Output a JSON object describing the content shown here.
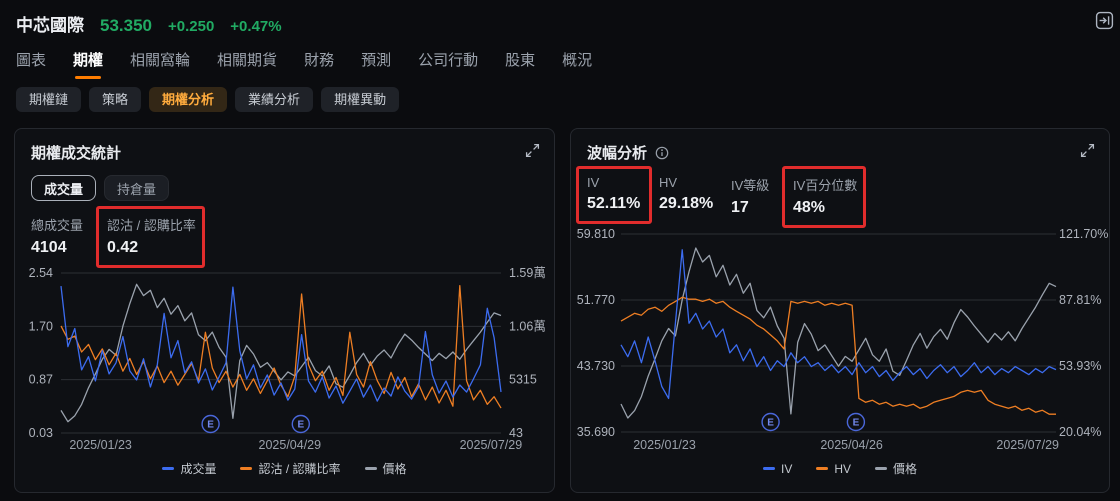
{
  "theme": {
    "up_color": "#21ab63",
    "accent_color": "#ff7d00",
    "annotation_color": "#e12c2c",
    "background": "#0b0c0f",
    "panel_background": "#0e1014"
  },
  "header": {
    "symbol": "中芯國際",
    "price": "53.350",
    "change": "+0.250",
    "change_pct": "+0.47%",
    "collapse_icon": "collapse-right-icon"
  },
  "tabs": [
    {
      "name": "chart",
      "label": "圖表",
      "active": false
    },
    {
      "name": "options",
      "label": "期權",
      "active": true
    },
    {
      "name": "related-warrants",
      "label": "相關窩輪",
      "active": false
    },
    {
      "name": "related-futures",
      "label": "相關期貨",
      "active": false
    },
    {
      "name": "financials",
      "label": "財務",
      "active": false
    },
    {
      "name": "forecast",
      "label": "預測",
      "active": false
    },
    {
      "name": "corporate-actions",
      "label": "公司行動",
      "active": false
    },
    {
      "name": "shareholders",
      "label": "股東",
      "active": false
    },
    {
      "name": "overview",
      "label": "概況",
      "active": false
    }
  ],
  "subtabs": [
    {
      "name": "option-chain",
      "label": "期權鏈",
      "active": false
    },
    {
      "name": "strategy",
      "label": "策略",
      "active": false
    },
    {
      "name": "option-analysis",
      "label": "期權分析",
      "active": true
    },
    {
      "name": "earnings-analysis",
      "label": "業績分析",
      "active": false
    },
    {
      "name": "option-unusual-activity",
      "label": "期權異動",
      "active": false
    }
  ],
  "panels": {
    "volume_stats": {
      "title": "期權成交統計",
      "expand_icon": "expand-icon",
      "toggles": [
        {
          "name": "volume",
          "label": "成交量",
          "active": true
        },
        {
          "name": "open-interest",
          "label": "持倉量",
          "active": false
        }
      ],
      "stats": [
        {
          "name": "total-volume",
          "label": "總成交量",
          "value": "4104",
          "highlighted": false
        },
        {
          "name": "put-call-ratio",
          "label": "認沽 / 認購比率",
          "value": "0.42",
          "highlighted": true
        }
      ],
      "chart": {
        "type": "line",
        "left_axis_labels": [
          "2.54",
          "1.70",
          "0.87",
          "0.03"
        ],
        "right_axis_labels": [
          "1.59萬",
          "1.06萬",
          "5315",
          "43"
        ],
        "left_axis_range": [
          0.03,
          2.54
        ],
        "right_axis_range": [
          43,
          15900
        ],
        "x_ticks": [
          {
            "label": "2025/01/23",
            "frac": 0.09
          },
          {
            "label": "2025/04/29",
            "frac": 0.52
          },
          {
            "label": "2025/07/29",
            "frac": 0.977
          }
        ],
        "earnings_marker": "E",
        "earnings_fracs": [
          0.34,
          0.545
        ],
        "series": [
          {
            "id": "volume",
            "name": "成交量",
            "color": "#3c6cf0",
            "min": 43,
            "max": 15900,
            "values": [
              14600,
              8600,
              10400,
              6300,
              7600,
              5200,
              8200,
              5900,
              7000,
              9600,
              6200,
              5300,
              7400,
              4600,
              6800,
              11900,
              7500,
              9200,
              6000,
              7100,
              5000,
              6400,
              4300,
              5600,
              7000,
              14500,
              8200,
              5400,
              6800,
              4500,
              5800,
              3800,
              5000,
              3300,
              4400,
              9800,
              5200,
              4100,
              5600,
              3500,
              4700,
              3000,
              4200,
              5400,
              3600,
              4800,
              3200,
              4500,
              3700,
              5600,
              4200,
              3400,
              4600,
              10100,
              5800,
              4000,
              5200,
              3600,
              4800,
              4100,
              5400,
              6800,
              12400,
              9500,
              4104
            ]
          },
          {
            "id": "put-call-ratio",
            "name": "認沽 / 認購比率",
            "color": "#ee7e23",
            "min": 0.03,
            "max": 2.54,
            "values": [
              1.71,
              1.5,
              1.55,
              1.3,
              1.42,
              1.18,
              1.35,
              1.1,
              1.28,
              1.0,
              1.2,
              0.95,
              1.15,
              0.88,
              1.08,
              0.82,
              1.0,
              0.78,
              0.95,
              1.12,
              0.85,
              1.61,
              1.05,
              0.82,
              1.0,
              0.75,
              0.95,
              0.7,
              0.88,
              0.65,
              0.85,
              1.05,
              0.78,
              0.6,
              0.92,
              2.21,
              1.1,
              0.85,
              1.0,
              0.7,
              0.9,
              0.62,
              1.61,
              0.95,
              0.75,
              1.15,
              0.85,
              0.65,
              0.98,
              0.72,
              0.9,
              0.6,
              0.8,
              0.55,
              0.75,
              0.5,
              0.7,
              0.45,
              2.34,
              0.85,
              0.55,
              0.7,
              0.48,
              0.6,
              0.42
            ]
          },
          {
            "id": "price",
            "name": "價格",
            "color": "#9aa2ad",
            "min": 35.69,
            "max": 59.81,
            "values": [
              39.1,
              37.4,
              38.3,
              40.0,
              42.5,
              44.6,
              46.8,
              48.3,
              47.4,
              51.8,
              55.2,
              58.1,
              56.4,
              57.2,
              54.6,
              56.0,
              53.6,
              54.9,
              52.6,
              53.8,
              50.5,
              49.6,
              50.9,
              48.6,
              47.1,
              37.9,
              46.6,
              48.9,
              47.6,
              45.6,
              46.3,
              45.0,
              43.7,
              44.9,
              44.3,
              45.7,
              47.1,
              45.1,
              44.3,
              45.8,
              43.1,
              42.6,
              44.4,
              46.3,
              47.7,
              45.9,
              47.3,
              48.2,
              47.0,
              49.0,
              50.6,
              49.7,
              48.6,
              47.6,
              46.6,
              47.7,
              46.9,
              47.9,
              46.8,
              48.3,
              49.6,
              50.9,
              52.4,
              53.8,
              53.4
            ]
          }
        ]
      }
    },
    "volatility": {
      "title": "波幅分析",
      "info_icon": "info-icon",
      "expand_icon": "expand-icon",
      "stats": [
        {
          "name": "iv",
          "label": "IV",
          "value": "52.11%",
          "highlighted": true
        },
        {
          "name": "hv",
          "label": "HV",
          "value": "29.18%",
          "highlighted": false
        },
        {
          "name": "iv-rank",
          "label": "IV等級",
          "value": "17",
          "highlighted": false
        },
        {
          "name": "iv-percentile",
          "label": "IV百分位數",
          "value": "48%",
          "highlighted": true
        }
      ],
      "chart": {
        "type": "line",
        "left_axis_labels": [
          "59.810",
          "51.770",
          "43.730",
          "35.690"
        ],
        "right_axis_labels": [
          "121.70%",
          "87.81%",
          "53.93%",
          "20.04%"
        ],
        "left_axis_range": [
          35.69,
          59.81
        ],
        "right_axis_range": [
          20.04,
          121.7
        ],
        "x_ticks": [
          {
            "label": "2025/01/23",
            "frac": 0.1
          },
          {
            "label": "2025/04/26",
            "frac": 0.53
          },
          {
            "label": "2025/07/29",
            "frac": 0.935
          }
        ],
        "earnings_marker": "E",
        "earnings_fracs": [
          0.344,
          0.54
        ],
        "series": [
          {
            "id": "iv",
            "name": "IV",
            "color": "#3c6cf0",
            "min": 20.04,
            "max": 121.7,
            "values": [
              64.8,
              58.7,
              66.8,
              55.6,
              68.8,
              56.6,
              43.4,
              37.3,
              75.9,
              113.6,
              75.9,
              81.0,
              72.9,
              77.0,
              68.8,
              72.9,
              60.7,
              64.8,
              56.6,
              62.7,
              53.6,
              58.7,
              51.6,
              56.6,
              53.6,
              60.7,
              55.6,
              58.7,
              53.6,
              55.6,
              51.6,
              54.6,
              50.5,
              53.6,
              49.5,
              55.6,
              50.5,
              53.6,
              48.5,
              51.6,
              46.5,
              50.5,
              53.6,
              49.5,
              52.6,
              47.5,
              51.6,
              54.6,
              50.5,
              53.6,
              48.5,
              51.6,
              55.6,
              50.5,
              53.6,
              49.5,
              52.6,
              50.5,
              53.6,
              51.6,
              49.5,
              52.6,
              50.5,
              53.6,
              52.1
            ]
          },
          {
            "id": "hv",
            "name": "HV",
            "color": "#ee7e23",
            "min": 20.04,
            "max": 121.7,
            "values": [
              77.0,
              79.0,
              81.0,
              80.0,
              83.1,
              84.1,
              82.0,
              85.1,
              87.1,
              89.2,
              88.2,
              88.2,
              87.1,
              88.2,
              86.1,
              87.1,
              84.1,
              82.0,
              80.0,
              78.0,
              74.9,
              72.9,
              69.9,
              66.8,
              62.7,
              87.1,
              86.1,
              87.1,
              86.1,
              87.1,
              85.1,
              86.1,
              85.1,
              86.1,
              85.1,
              37.3,
              35.3,
              36.3,
              34.3,
              35.3,
              33.3,
              34.3,
              33.3,
              34.3,
              32.2,
              33.3,
              35.3,
              36.3,
              37.3,
              38.3,
              40.4,
              41.4,
              40.4,
              41.4,
              36.3,
              34.3,
              33.3,
              32.2,
              33.3,
              31.2,
              32.2,
              30.2,
              31.2,
              29.2,
              29.2
            ]
          },
          {
            "id": "price",
            "name": "價格",
            "color": "#9aa2ad",
            "min": 35.69,
            "max": 59.81,
            "values": [
              39.1,
              37.4,
              38.3,
              40.0,
              42.5,
              44.6,
              46.8,
              48.3,
              47.4,
              51.8,
              55.2,
              58.1,
              56.4,
              57.2,
              54.6,
              56.0,
              53.6,
              54.9,
              52.6,
              53.8,
              50.5,
              49.6,
              50.9,
              48.6,
              47.1,
              37.9,
              46.6,
              48.9,
              47.6,
              45.6,
              46.3,
              45.0,
              43.7,
              44.9,
              44.3,
              45.7,
              47.1,
              45.1,
              44.3,
              45.8,
              43.1,
              42.6,
              44.4,
              46.3,
              47.7,
              45.9,
              47.3,
              48.2,
              47.0,
              49.0,
              50.6,
              49.7,
              48.6,
              47.6,
              46.6,
              47.7,
              46.9,
              47.9,
              46.8,
              48.3,
              49.6,
              50.9,
              52.4,
              53.8,
              53.4
            ]
          }
        ]
      }
    }
  }
}
